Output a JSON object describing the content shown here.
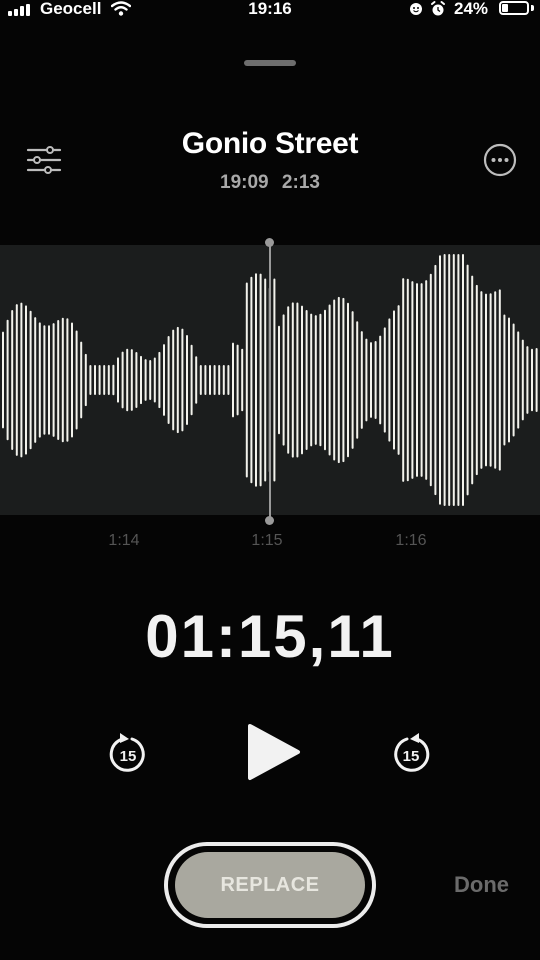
{
  "status_bar": {
    "carrier": "Geocell",
    "time": "19:16",
    "battery_percent_label": "24%",
    "battery_level": 0.24
  },
  "recording": {
    "title": "Gonio Street",
    "time": "19:09",
    "duration": "2:13"
  },
  "timeline": {
    "ticks": [
      "1:14",
      "1:15",
      "1:16"
    ]
  },
  "player": {
    "elapsed": "01:15,11",
    "skip_back_label": "15",
    "skip_forward_label": "15"
  },
  "actions": {
    "replace_label": "REPLACE",
    "done_label": "Done"
  },
  "icons": {
    "settings": "sliders-icon",
    "more": "ellipsis-circle-icon",
    "play": "play-icon",
    "skip_back": "skip-back-15-icon",
    "skip_forward": "skip-forward-15-icon"
  },
  "colors": {
    "background": "#050505",
    "waveform_band": "#1b1d1d",
    "waveform_bars": "#f2f2ec",
    "replace_fill": "#a9a89f",
    "done_text": "#6b6b6b"
  }
}
